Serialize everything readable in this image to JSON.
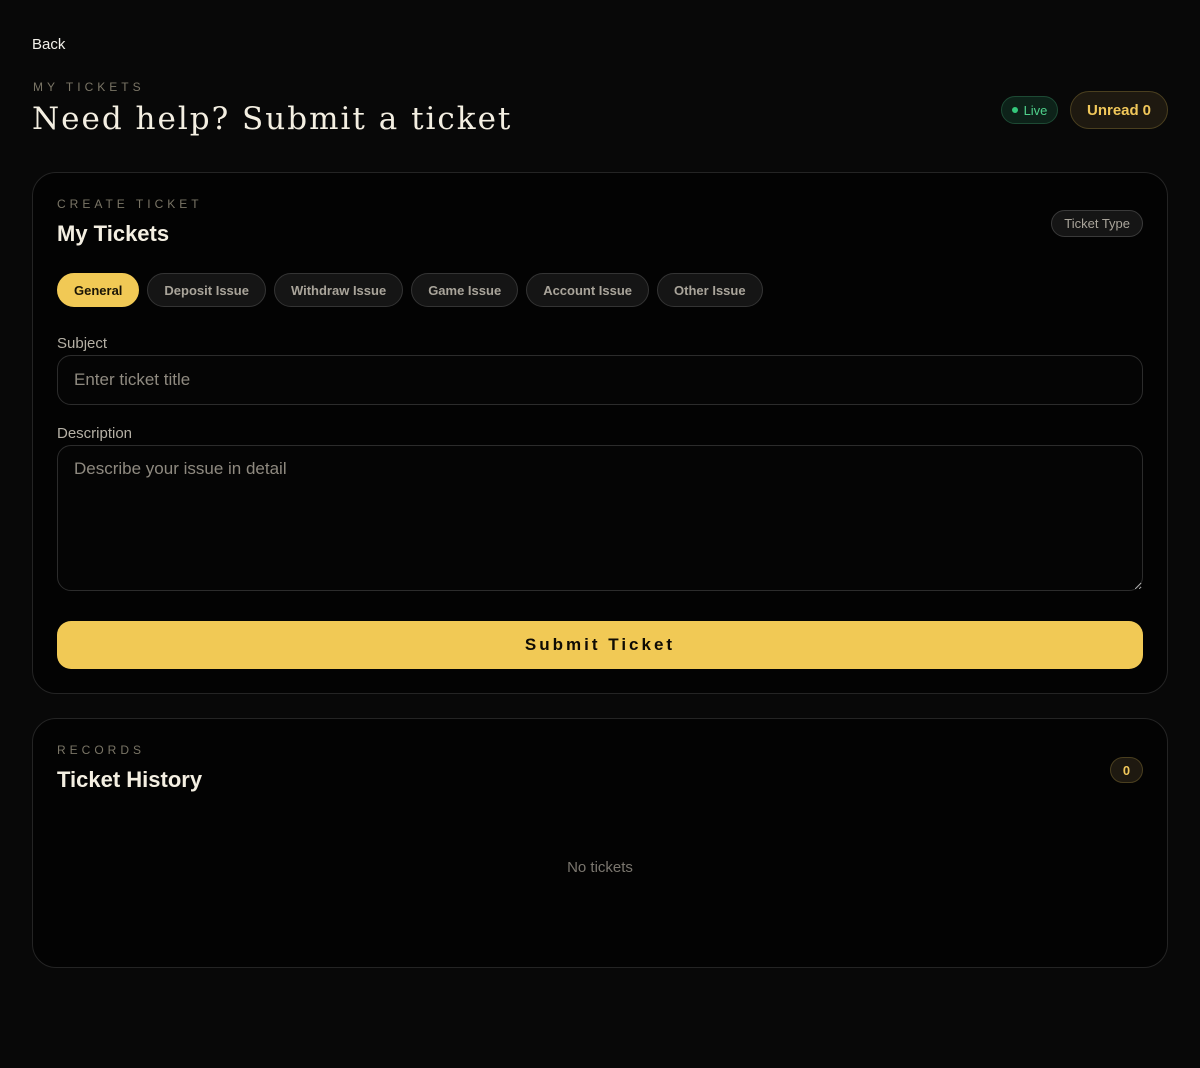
{
  "nav": {
    "back_label": "Back"
  },
  "header": {
    "eyebrow": "MY TICKETS",
    "title": "Need help? Submit a ticket",
    "live_label": "Live",
    "unread_label": "Unread",
    "unread_count": "0"
  },
  "create": {
    "eyebrow": "CREATE TICKET",
    "title": "My Tickets",
    "type_badge": "Ticket Type",
    "types": [
      {
        "label": "General",
        "active": true
      },
      {
        "label": "Deposit Issue",
        "active": false
      },
      {
        "label": "Withdraw Issue",
        "active": false
      },
      {
        "label": "Game Issue",
        "active": false
      },
      {
        "label": "Account Issue",
        "active": false
      },
      {
        "label": "Other Issue",
        "active": false
      }
    ],
    "subject_label": "Subject",
    "subject_placeholder": "Enter ticket title",
    "subject_value": "",
    "description_label": "Description",
    "description_placeholder": "Describe your issue in detail",
    "description_value": "",
    "submit_label": "Submit Ticket"
  },
  "history": {
    "eyebrow": "RECORDS",
    "title": "Ticket History",
    "count": "0",
    "empty_text": "No tickets"
  },
  "colors": {
    "accent": "#f1c955",
    "live": "#4fd18b",
    "background": "#080808"
  }
}
